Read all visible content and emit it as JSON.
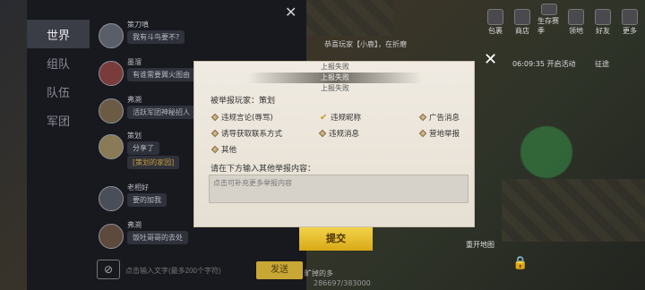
{
  "top_icons": [
    {
      "label": "包裹",
      "icon": "bag-icon"
    },
    {
      "label": "商店",
      "icon": "shop-icon"
    },
    {
      "label": "生存赛季",
      "icon": "season-icon"
    },
    {
      "label": "领地",
      "icon": "territory-icon"
    },
    {
      "label": "好友",
      "icon": "friends-icon"
    },
    {
      "label": "更多",
      "icon": "more-icon"
    }
  ],
  "timer": "06:09:35 开启活动",
  "timer_side": "征途",
  "notice": "恭喜玩家【小鹿】，在折磨",
  "chat": {
    "tabs": [
      "世界",
      "组队",
      "队伍",
      "军团"
    ],
    "messages": [
      {
        "name": "策刀嗔",
        "badge": "",
        "text": "我有斗鸟要不?",
        "extra": ""
      },
      {
        "name": "墨溜",
        "badge": "",
        "text": "有谁需要翼火图由",
        "extra": ""
      },
      {
        "name": "弗溯",
        "badge": "",
        "text": "活跃军团神秘招人",
        "extra": ""
      },
      {
        "name": "策划",
        "badge": "",
        "text": "分享了",
        "extra": "[策划的家园]"
      },
      {
        "name": "老相好",
        "badge": "",
        "text": "要的加我",
        "extra": ""
      },
      {
        "name": "弗溯",
        "badge": "",
        "text": "饭吐哥哥的去处",
        "extra": ""
      }
    ],
    "input_placeholder": "点击输入文字(最多200个字符)",
    "send_label": "发送"
  },
  "modal": {
    "toasts": [
      "上报失败",
      "上报失败",
      "上报失败"
    ],
    "reported_player_label": "被举报玩家：策划",
    "options": [
      {
        "label": "违规言论(辱骂)",
        "checked": false
      },
      {
        "label": "违规昵称",
        "checked": true
      },
      {
        "label": "广告消息",
        "checked": false
      },
      {
        "label": "诱导获取联系方式",
        "checked": false
      },
      {
        "label": "违规消息",
        "checked": false
      },
      {
        "label": "营地举报",
        "checked": false
      },
      {
        "label": "其他",
        "checked": false
      }
    ],
    "prompt_label": "请在下方输入其他举报内容：",
    "textarea_placeholder": "点击可补充更多举报内容",
    "submit_label": "提交"
  },
  "bottom": {
    "left_text": "旷掉的多",
    "progress_text": "286697/383000",
    "map_label": "重开地图"
  }
}
